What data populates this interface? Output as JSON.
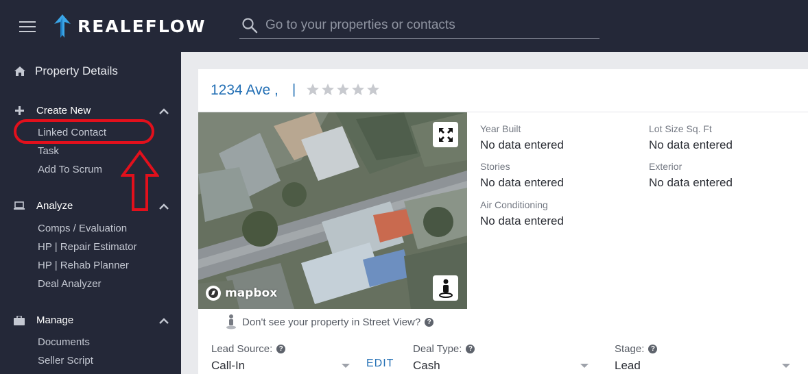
{
  "header": {
    "logo_text": "REALEFLOW",
    "search_placeholder": "Go to your properties or contacts"
  },
  "sidebar": {
    "property_details": "Property Details",
    "sections": [
      {
        "label": "Create New",
        "items": [
          "Linked Contact",
          "Task",
          "Add To Scrum"
        ]
      },
      {
        "label": "Analyze",
        "items": [
          "Comps / Evaluation",
          "HP | Repair Estimator",
          "HP | Rehab Planner",
          "Deal Analyzer"
        ]
      },
      {
        "label": "Manage",
        "items": [
          "Documents",
          "Seller Script"
        ]
      }
    ]
  },
  "property": {
    "address": "1234 Ave ,",
    "address_separator": "|",
    "rating": 0,
    "rating_max": 5,
    "map_attribution": "mapbox",
    "street_view_note": "Don't see your property in Street View?",
    "details": [
      {
        "label": "Year Built",
        "value": "No data entered"
      },
      {
        "label": "Lot Size Sq. Ft",
        "value": "No data entered"
      },
      {
        "label": "Stories",
        "value": "No data entered"
      },
      {
        "label": "Exterior",
        "value": "No data entered"
      },
      {
        "label": "Air Conditioning",
        "value": "No data entered"
      }
    ],
    "lead_source": {
      "label": "Lead Source:",
      "value": "Call-In"
    },
    "edit_label": "EDIT",
    "deal_type": {
      "label": "Deal Type:",
      "value": "Cash"
    },
    "stage": {
      "label": "Stage:",
      "value": "Lead"
    }
  },
  "colors": {
    "nav_bg": "#242838",
    "accent_blue": "#2470b5",
    "annotation_red": "#e2101c"
  }
}
